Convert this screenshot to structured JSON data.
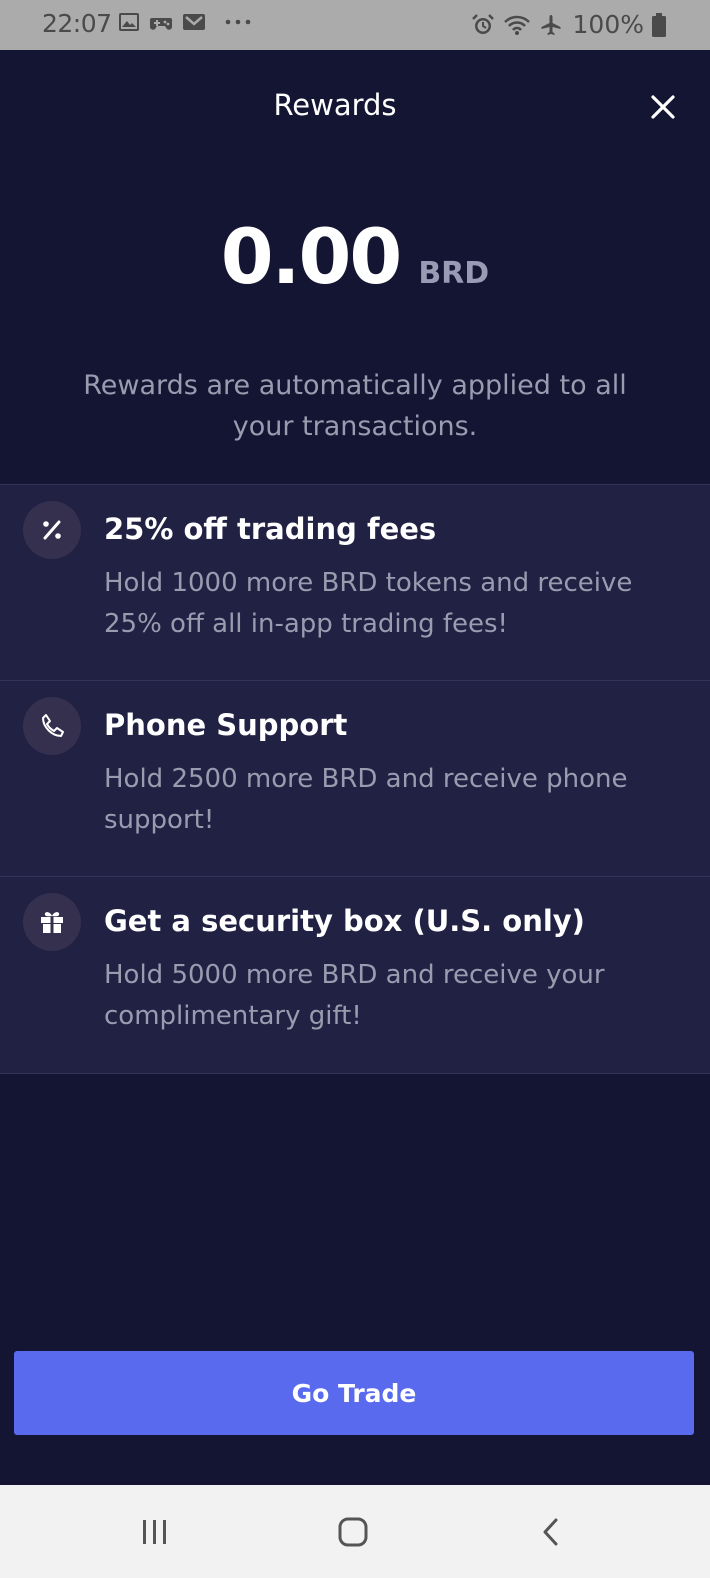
{
  "status_bar": {
    "time": "22:07",
    "battery": "100%",
    "left_icons": [
      "image-icon",
      "game-icon",
      "gmail-icon",
      "more-dots-icon"
    ],
    "right_icons": [
      "alarm-icon",
      "wifi-icon",
      "airplane-icon",
      "battery-icon"
    ]
  },
  "header": {
    "title": "Rewards",
    "close_icon": "close-icon"
  },
  "balance": {
    "amount": "0.00",
    "currency": "BRD",
    "description": "Rewards are automatically applied to all your transactions."
  },
  "rewards": [
    {
      "icon": "percent-icon",
      "title": "25% off trading fees",
      "description": "Hold 1000 more BRD tokens and receive 25% off all in-app trading fees!"
    },
    {
      "icon": "phone-icon",
      "title": "Phone Support",
      "description": "Hold 2500 more BRD and receive phone support!"
    },
    {
      "icon": "gift-icon",
      "title": "Get a security box (U.S. only)",
      "description": "Hold 5000 more BRD and receive your complimentary gift!"
    }
  ],
  "primary_button": {
    "label": "Go Trade"
  },
  "colors": {
    "background": "#141433",
    "list_background": "#212144",
    "accent": "#5a6aee",
    "secondary_text": "#9b9bb0"
  },
  "nav_bar": {
    "buttons": [
      "recent-apps-icon",
      "home-icon",
      "back-icon"
    ]
  }
}
